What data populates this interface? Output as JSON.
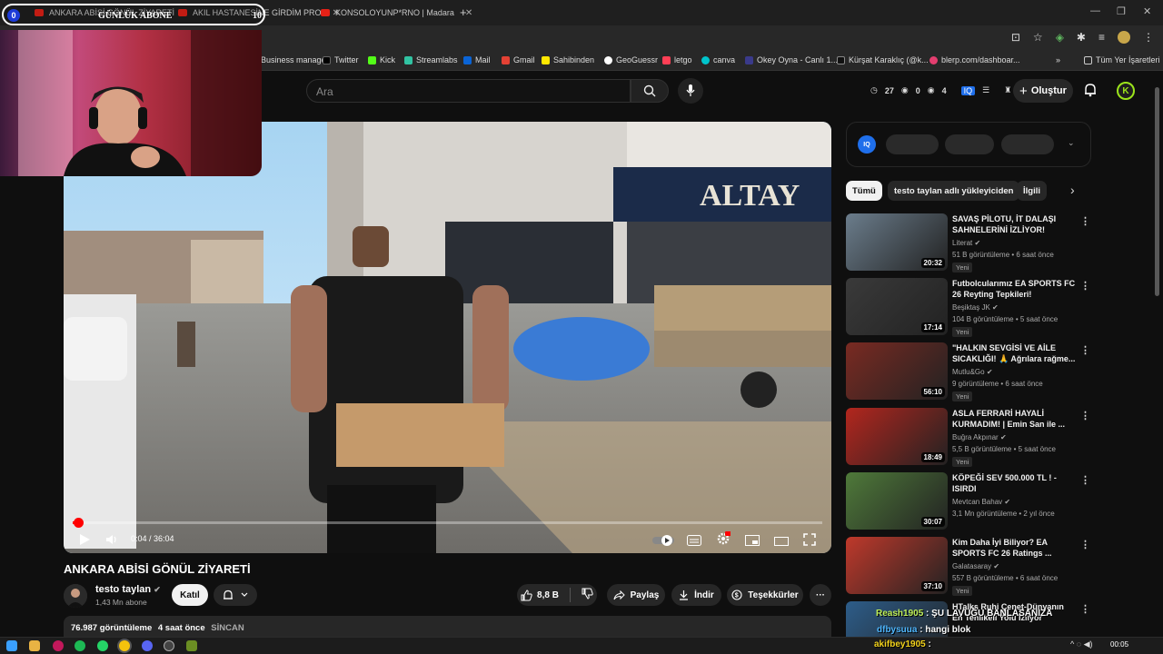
{
  "browser": {
    "tabs": [
      {
        "label": "ANKARA ABİSİ GÖNÜL ZİYARETİ"
      },
      {
        "label": "AKIL HASTANESİNE GİRDİM PRO"
      },
      {
        "label": "KONSOLOYUNP*RNO | Madara"
      }
    ],
    "new_tab": "+",
    "bookmarks": [
      "Business manager",
      "Twitter",
      "Kick",
      "Streamlabs",
      "Mail",
      "Gmail",
      "Sahibinden",
      "GeoGuessr",
      "letgo",
      "canva",
      "Okey Oyna - Canlı 1...",
      "Kürşat Karaklıç (@k...",
      "blerp.com/dashboar..."
    ],
    "bookmarks_more": "»",
    "all_bookmarks": "Tüm Yer İşaretleri"
  },
  "overlay": {
    "left_num": "0",
    "title": "GÜNLÜK ABONE",
    "count": "10"
  },
  "youtube": {
    "search_placeholder": "Ara",
    "stats": {
      "a": "27",
      "b": "0",
      "c": "4"
    },
    "create_label": "Oluştur",
    "avatar_letter": "K"
  },
  "video": {
    "current_time": "0:04",
    "duration": "36:04",
    "time_display": "0:04 / 36:04",
    "progress": 0.0018,
    "title": "ANKARA ABİSİ GÖNÜL ZİYARETİ",
    "channel": "testo taylan",
    "subscribers": "1,43 Mn abone",
    "join_label": "Katıl",
    "likes": "8,8 B",
    "share_label": "Paylaş",
    "download_label": "İndir",
    "thanks_label": "Teşekkürler",
    "views": "76.987 görüntüleme",
    "age": "4 saat önce",
    "location": "SİNCAN"
  },
  "sidebar": {
    "ad_label": "IQ",
    "chips": [
      "Tümü",
      "testo taylan adlı yükleyiciden",
      "İlgili"
    ],
    "recommendations": [
      {
        "title": "SAVAŞ PİLOTU, İT DALAŞI SAHNELERİNİ İZLİYOR!",
        "channel": "Literat",
        "meta": "51 B görüntüleme • 6 saat önce",
        "badge": "Yeni",
        "duration": "20:32",
        "color": "#6b7d8c"
      },
      {
        "title": "Futbolcularımız EA SPORTS FC 26 Reyting Tepkileri!",
        "channel": "Beşiktaş JK",
        "meta": "104 B görüntüleme • 5 saat önce",
        "badge": "Yeni",
        "duration": "17:14",
        "color": "#3a3a3a"
      },
      {
        "title": "\"HALKIN SEVGİSİ VE AİLE SICAKLIĞI! 🙏 Ağrılara rağme...",
        "channel": "Mutlu&Go",
        "meta": "9 görüntüleme • 6 saat önce",
        "badge": "Yeni",
        "duration": "56:10",
        "color": "#7a2a22"
      },
      {
        "title": "ASLA FERRARİ HAYALİ KURMADIM! | Emin San ile ...",
        "channel": "Buğra Akpınar",
        "meta": "5,5 B görüntüleme • 5 saat önce",
        "badge": "Yeni",
        "duration": "18:49",
        "color": "#b3261e"
      },
      {
        "title": "KÖPEĞİ SEV 500.000 TL ! - ISIRDI",
        "channel": "Mevtcan Bahav",
        "meta": "3,1 Mn görüntüleme • 2 yıl önce",
        "badge": "",
        "duration": "30:07",
        "color": "#4f7a3a"
      },
      {
        "title": "Kim Daha İyi Biliyor? EA SPORTS FC 26 Ratings ...",
        "channel": "Galatasaray",
        "meta": "557 B görüntüleme • 6 saat önce",
        "badge": "Yeni",
        "duration": "37:10",
        "color": "#c0392b"
      },
      {
        "title": "HTalks Ruhi Çenet-Dünyanın En Tehlikeli Yolu İzliyor",
        "channel": "",
        "meta": "",
        "badge": "",
        "duration": "",
        "color": "#2d5d8a"
      }
    ]
  },
  "chat": [
    {
      "user": "Reash1905",
      "text": ": ŞU LAVUĞU BANLASANIZA"
    },
    {
      "user": "dfbysuua",
      "text": ": hangi blok"
    },
    {
      "user": "akifbey1905",
      "text": ":"
    }
  ],
  "taskbar": {
    "clock": "00:05"
  },
  "colors": {
    "accent_red": "#ff0000",
    "bg": "#0f0f0f",
    "chip": "#272727"
  }
}
